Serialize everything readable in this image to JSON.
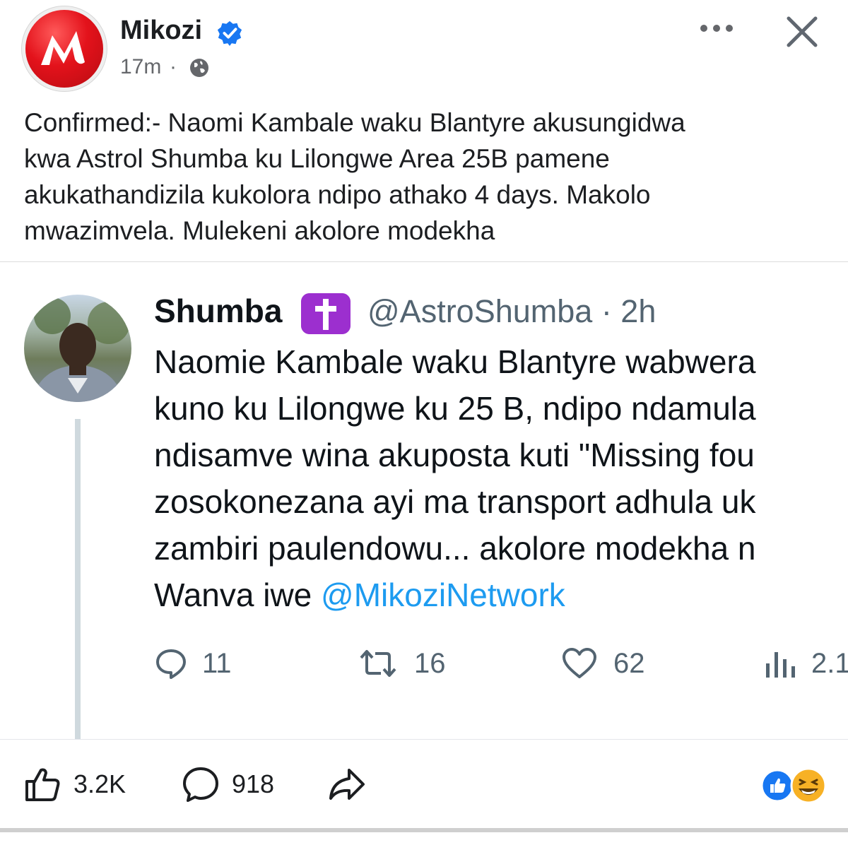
{
  "header": {
    "page_name": "Mikozi",
    "time": "17m",
    "dot": "·"
  },
  "caption": "Confirmed:- Naomi Kambale waku Blantyre akusungidwa\nkwa Astrol Shumba ku Lilongwe Area 25B  pamene\nakukathandizila kukolora ndipo athako 4 days. Makolo\nmwazimvela. Mulekeni akolore modekha",
  "tweet": {
    "name": "Shumba",
    "handle_time": "@AstroShumba · 2h",
    "lines": [
      "Naomie Kambale waku Blantyre wabwera",
      "kuno ku Lilongwe ku 25 B, ndipo ndamula",
      "ndisamve wina akuposta kuti \"Missing fou",
      "zosokonezana ayi ma transport adhula uk",
      "zambiri paulendowu... akolore modekha n"
    ],
    "last_line_prefix": "Wanva iwe ",
    "mention": "@MikoziNetwork",
    "replies": "11",
    "retweets": "16",
    "likes": "62",
    "views": "2.1"
  },
  "footer": {
    "likes": "3.2K",
    "comments": "918"
  },
  "colors": {
    "brand_red": "#e3121b",
    "verified_blue": "#1877f2",
    "twitter_link": "#1d9bf0",
    "cross_purple": "#9c2fcf"
  },
  "icons": [
    "mikozi-logo-icon",
    "verified-badge-icon",
    "globe-icon",
    "more-icon",
    "close-icon",
    "latin-cross-icon",
    "reply-icon",
    "retweet-icon",
    "heart-icon",
    "views-icon",
    "like-icon",
    "comment-icon",
    "share-icon",
    "like-reaction-icon",
    "haha-reaction-icon"
  ]
}
